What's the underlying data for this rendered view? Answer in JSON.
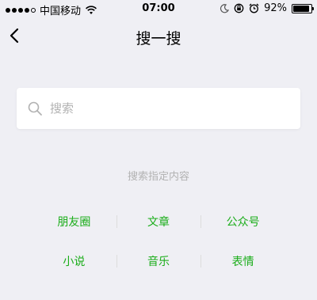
{
  "status_bar": {
    "carrier": "中国移动",
    "time": "07:00",
    "battery": "92%",
    "battery_level": 0.92
  },
  "nav": {
    "title": "搜一搜"
  },
  "search": {
    "placeholder": "搜索"
  },
  "hint": "搜索指定内容",
  "categories": [
    [
      "朋友圈",
      "文章",
      "公众号"
    ],
    [
      "小说",
      "音乐",
      "表情"
    ]
  ],
  "colors": {
    "accent": "#1aad19",
    "background": "#efeff4",
    "hint_text": "#b2b2b2"
  }
}
